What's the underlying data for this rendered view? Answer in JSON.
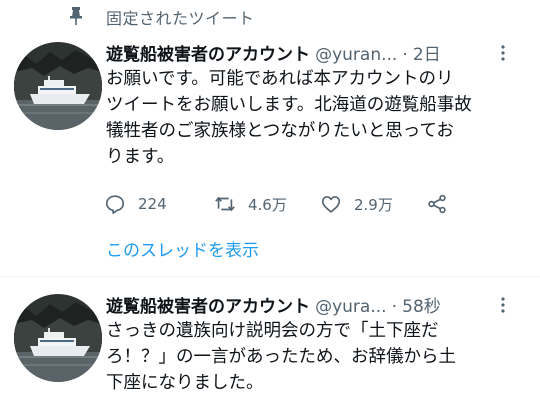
{
  "pinned": {
    "label": "固定されたツイート"
  },
  "tweets": [
    {
      "name": "遊覧船被害者のアカウント",
      "handle": "@yuran...",
      "dot": "·",
      "time": "2日",
      "lines": [
        "お願いです。可能であれば本アカウントのリ",
        "ツイートをお願いします。北海道の遊覧船事故",
        "犠牲者のご家族様とつながりたいと思ってお",
        "ります。"
      ],
      "replies": "224",
      "retweets": "4.6万",
      "likes": "2.9万",
      "thread_link": "このスレッドを表示"
    },
    {
      "name": "遊覧船被害者のアカウント",
      "handle": "@yura...",
      "dot": "·",
      "time": "58秒",
      "lines": [
        "さっきの遺族向け説明会の方で「土下座だ",
        "ろ！？」の一言があったため、お辞儀から土",
        "下座になりました。"
      ]
    }
  ],
  "colors": {
    "text": "#0f1419",
    "secondary": "#536471",
    "link": "#1d9bf0",
    "divider": "#eff3f4"
  },
  "icons": [
    "pin-icon",
    "more-icon",
    "reply-icon",
    "retweet-icon",
    "like-icon",
    "share-icon"
  ]
}
